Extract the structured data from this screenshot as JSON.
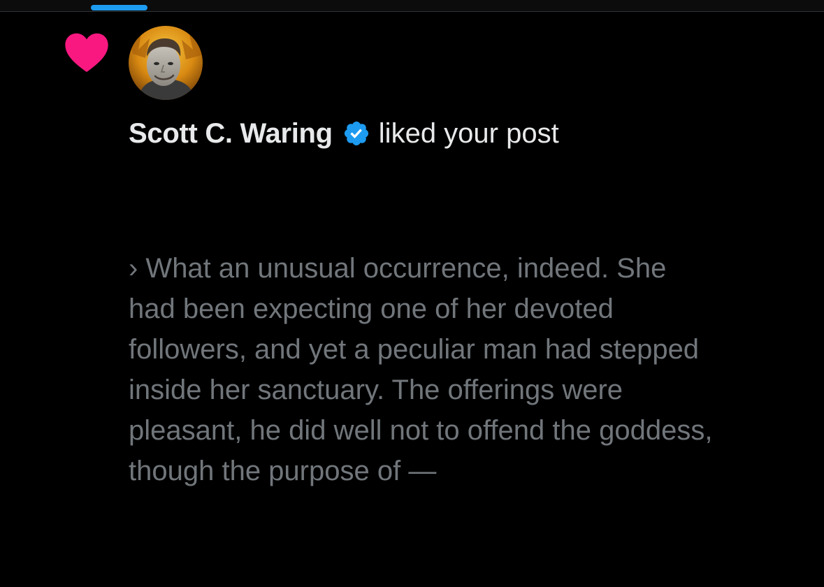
{
  "notification": {
    "type_icon": "heart-icon",
    "avatar_icon": "avatar",
    "user_name": "Scott C. Waring",
    "verified_icon": "verified-badge-icon",
    "action_text": "liked your post",
    "post_excerpt": "        › What an unusual occurrence, indeed. She\nhad been expecting one of her devoted\nfollowers, and yet a peculiar man had stepped\ninside her sanctuary. The offerings were\npleasant, he did well not to offend the goddess,\nthough the purpose of —"
  },
  "colors": {
    "background": "#000000",
    "accent": "#1d9bf0",
    "like": "#f91880",
    "primary_text": "#e7e9ea",
    "secondary_text": "#71767b"
  }
}
